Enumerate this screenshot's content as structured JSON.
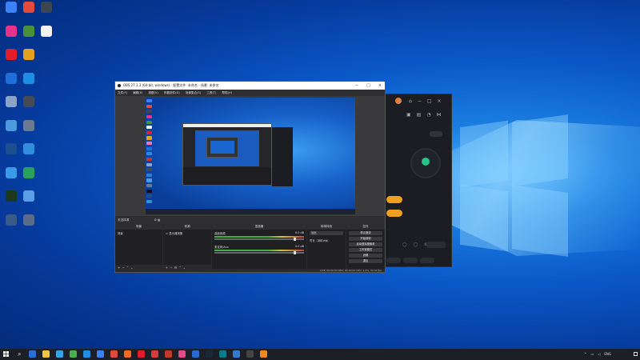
{
  "desktop": {
    "icons": [
      {
        "label": "",
        "color": "#3b82f6"
      },
      {
        "label": "",
        "color": "#e44b3c"
      },
      {
        "label": "",
        "color": "#3b4650"
      },
      {
        "label": "",
        "color": "#e7318a"
      },
      {
        "label": "",
        "color": "#4a8f3a"
      },
      {
        "label": "",
        "color": "#f2f2f2"
      },
      {
        "label": "",
        "color": "#e11d2a"
      },
      {
        "label": "",
        "color": "#e5a021"
      },
      {
        "label": "",
        "color": "#f472b6"
      },
      {
        "label": "",
        "color": "#1e6fd9"
      },
      {
        "label": "",
        "color": "#1f8fe6"
      },
      {
        "label": "",
        "color": "#c0392b"
      },
      {
        "label": "",
        "color": "#8aa4c8"
      },
      {
        "label": "",
        "color": "#444b55"
      },
      {
        "label": "",
        "color": "#2d7dd2"
      },
      {
        "label": "",
        "color": "#4b9ae0"
      },
      {
        "label": "",
        "color": "#6a7a90"
      },
      {
        "label": "",
        "color": "#111111"
      },
      {
        "label": "",
        "color": "#1c4f8f"
      },
      {
        "label": "",
        "color": "#2f8fdc"
      },
      {
        "label": "",
        "color": "#1e64c8"
      },
      {
        "label": "",
        "color": "#3a9ae8"
      },
      {
        "label": "",
        "color": "#2aa15a"
      },
      {
        "label": "",
        "color": "#e8c020"
      },
      {
        "label": "",
        "color": "#1b3a1b"
      },
      {
        "label": "",
        "color": "#5aa0e8"
      },
      {
        "label": "",
        "color": "#f08a1c"
      },
      {
        "label": "",
        "color": "#3a5a8a"
      },
      {
        "label": "",
        "color": "#5d6b8a"
      },
      {
        "label": "",
        "color": "#f0a01c"
      }
    ]
  },
  "obs": {
    "title": "OBS 27.1.3 (64-bit, windows) - 配置文件: 未命名 - 场景: 未命名",
    "menu": [
      "文件(F)",
      "编辑(E)",
      "视图(V)",
      "停靠部件(D)",
      "场景集合(S)",
      "工具(T)",
      "帮助(H)"
    ],
    "no_source": "未选择源",
    "docks": {
      "scenes": {
        "title": "场景",
        "item": "场景"
      },
      "sources": {
        "title": "来源",
        "item": "显示器采集"
      },
      "mixer": {
        "title": "混音器",
        "ch1": "麦克风/Aux",
        "ch1_db": "0.0 dB",
        "ch2": "桌面音频",
        "ch2_db": "0.0 dB"
      },
      "transitions": {
        "title": "转场特效",
        "fade": "淡出",
        "duration_label": "时长",
        "duration": "300 ms"
      },
      "controls": {
        "title": "控件",
        "buttons": [
          "停止推流",
          "开始录制",
          "启动虚拟摄像机",
          "工作室模式",
          "设置",
          "退出"
        ]
      }
    },
    "statusbar": "LIVE: 00:00:00  REC: 00:00:00  CPU: 1.0%, 30.00 fps"
  },
  "bg_app": {
    "badge": "",
    "center_text": "",
    "sub_text": ""
  },
  "taskbar": {
    "lang": "ENG",
    "time": "",
    "date": ""
  }
}
